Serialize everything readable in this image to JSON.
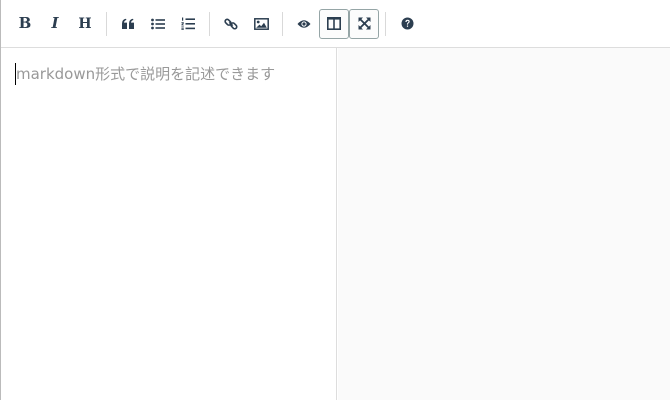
{
  "toolbar": {
    "buttons": [
      {
        "name": "bold",
        "glyph": "B",
        "icon": "bold-icon"
      },
      {
        "name": "italic",
        "glyph": "I",
        "icon": "italic-icon"
      },
      {
        "name": "heading",
        "glyph": "H",
        "icon": "heading-icon"
      },
      {
        "name": "quote",
        "icon": "quote-icon"
      },
      {
        "name": "unordered-list",
        "icon": "list-ul-icon"
      },
      {
        "name": "ordered-list",
        "icon": "list-ol-icon"
      },
      {
        "name": "link",
        "icon": "link-icon"
      },
      {
        "name": "image",
        "icon": "image-icon"
      },
      {
        "name": "preview",
        "icon": "eye-icon"
      },
      {
        "name": "side-by-side",
        "icon": "columns-icon",
        "active": true
      },
      {
        "name": "fullscreen",
        "icon": "arrows-alt-icon",
        "active": true
      },
      {
        "name": "guide",
        "icon": "question-circle-icon"
      }
    ]
  },
  "editor": {
    "placeholder": "markdown形式で説明を記述できます"
  },
  "colors": {
    "icon": "#2c3e50",
    "active_border": "#95a5a6",
    "placeholder": "#999999",
    "preview_bg": "#fafafa"
  }
}
